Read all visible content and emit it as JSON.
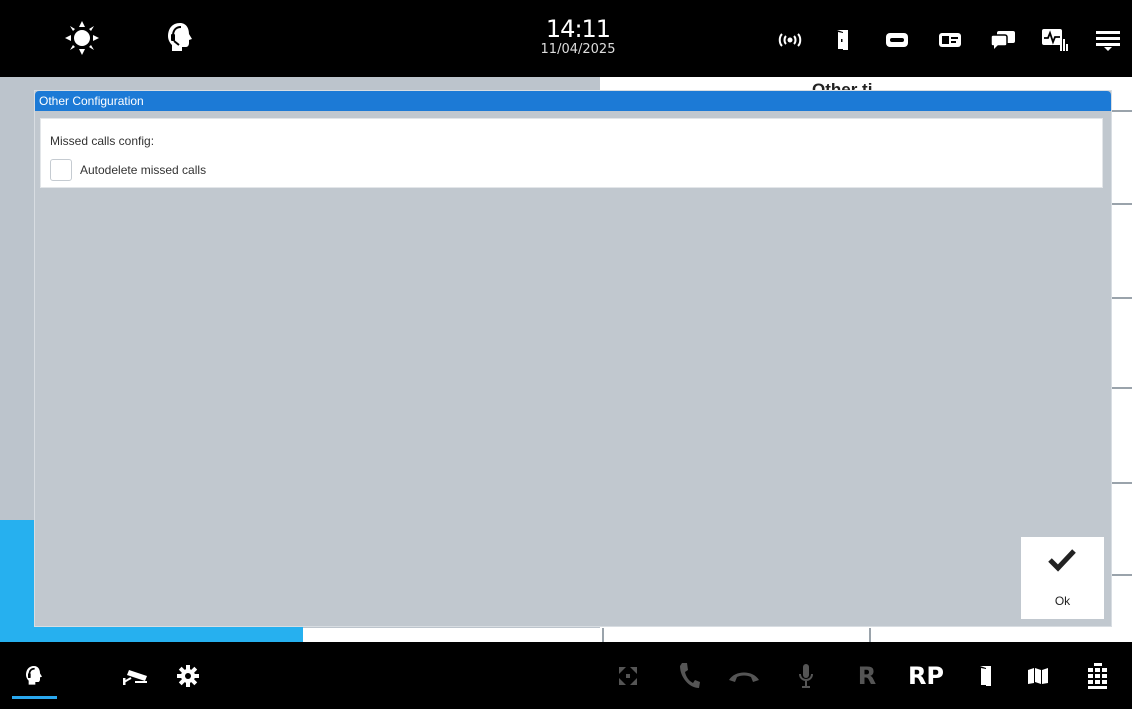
{
  "header": {
    "time": "14:11",
    "date": "11/04/2025",
    "icons": [
      "brightness-icon",
      "operator-headset-icon",
      "radio-signal-icon",
      "door-icon",
      "voicemail-icon",
      "contact-card-icon",
      "chat-icon",
      "monitor-chart-icon",
      "menu-icon"
    ]
  },
  "background": {
    "heading_fragment": "Other  ti"
  },
  "dialog": {
    "title": "Other Configuration",
    "section_label": "Missed calls config:",
    "checkbox_label": "Autodelete missed calls",
    "checkbox_checked": false,
    "ok_label": "Ok"
  },
  "footer": {
    "left_icons": [
      "operator-headset-icon",
      "security-camera-icon",
      "settings-gear-icon"
    ],
    "right_icons": [
      "fullscreen-icon",
      "phone-call-icon",
      "hang-up-icon",
      "microphone-icon"
    ],
    "recall_label": "R",
    "rp_label": "RP",
    "right_icons_2": [
      "door-icon",
      "map-icon",
      "keypad-icon"
    ]
  },
  "colors": {
    "accent_blue": "#1c7ad6",
    "active_blue": "#26b0ef",
    "dialog_bg": "#c1c8cf"
  }
}
